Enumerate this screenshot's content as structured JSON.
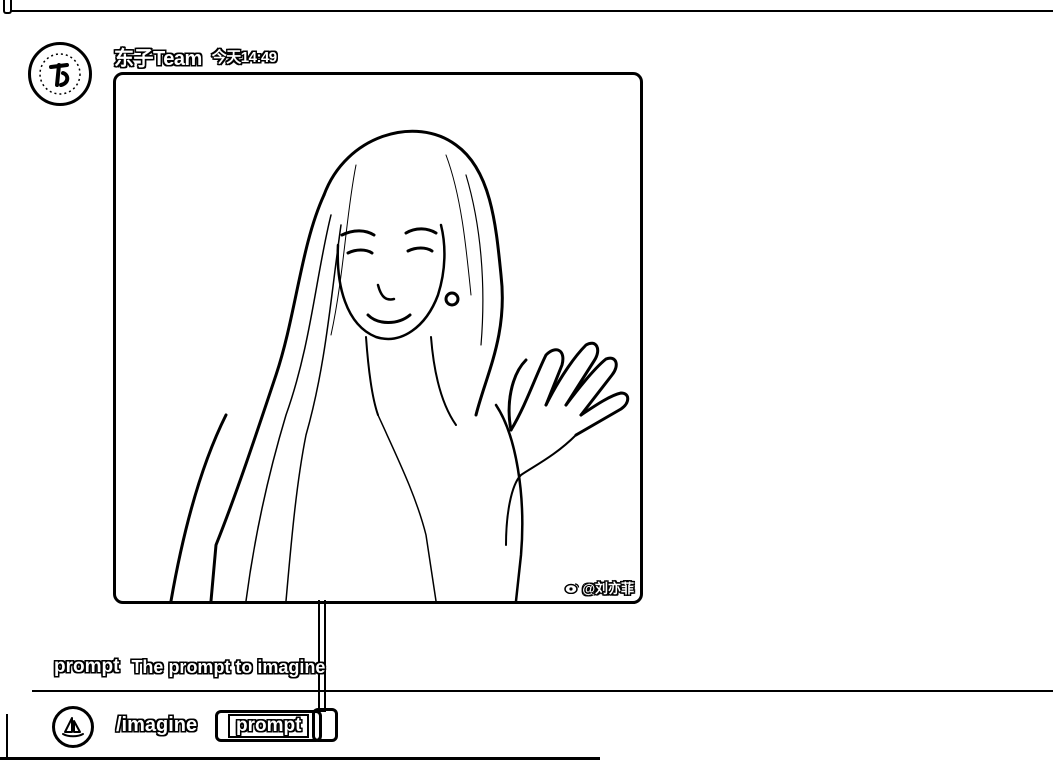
{
  "message": {
    "username": "东子Team",
    "timestamp": "今天14:49",
    "image": {
      "watermark": "@刘亦菲"
    }
  },
  "option_hint": {
    "name": "prompt",
    "description": "The prompt to imagine"
  },
  "composer": {
    "command": "/imagine",
    "param": "prompt"
  }
}
